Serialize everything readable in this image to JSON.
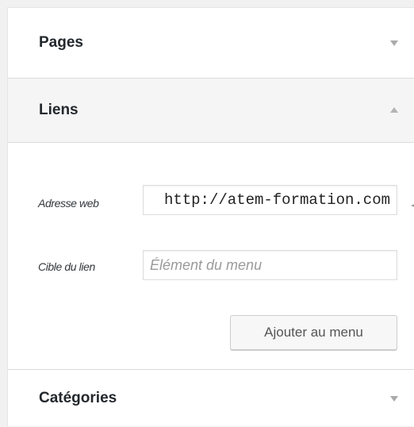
{
  "sections": {
    "pages": {
      "title": "Pages",
      "state": "collapsed"
    },
    "links": {
      "title": "Liens",
      "state": "expanded",
      "url_label": "Adresse web",
      "url_value": "http://atem-formation.com",
      "target_label": "Cible du lien",
      "target_placeholder": "Élément du menu",
      "add_button": "Ajouter au menu"
    },
    "categories": {
      "title": "Catégories",
      "state": "collapsed"
    }
  },
  "icons": {
    "pages_toggle": "chevron-down-icon",
    "links_toggle": "chevron-up-icon",
    "categories_toggle": "chevron-down-icon",
    "pointer": "arrow-pointer-icon"
  },
  "colors": {
    "panel_background": "#ffffff",
    "expanded_header_background": "#f5f5f5",
    "heading_text": "#23282d",
    "toggle_arrow": "#aaaaaa"
  }
}
